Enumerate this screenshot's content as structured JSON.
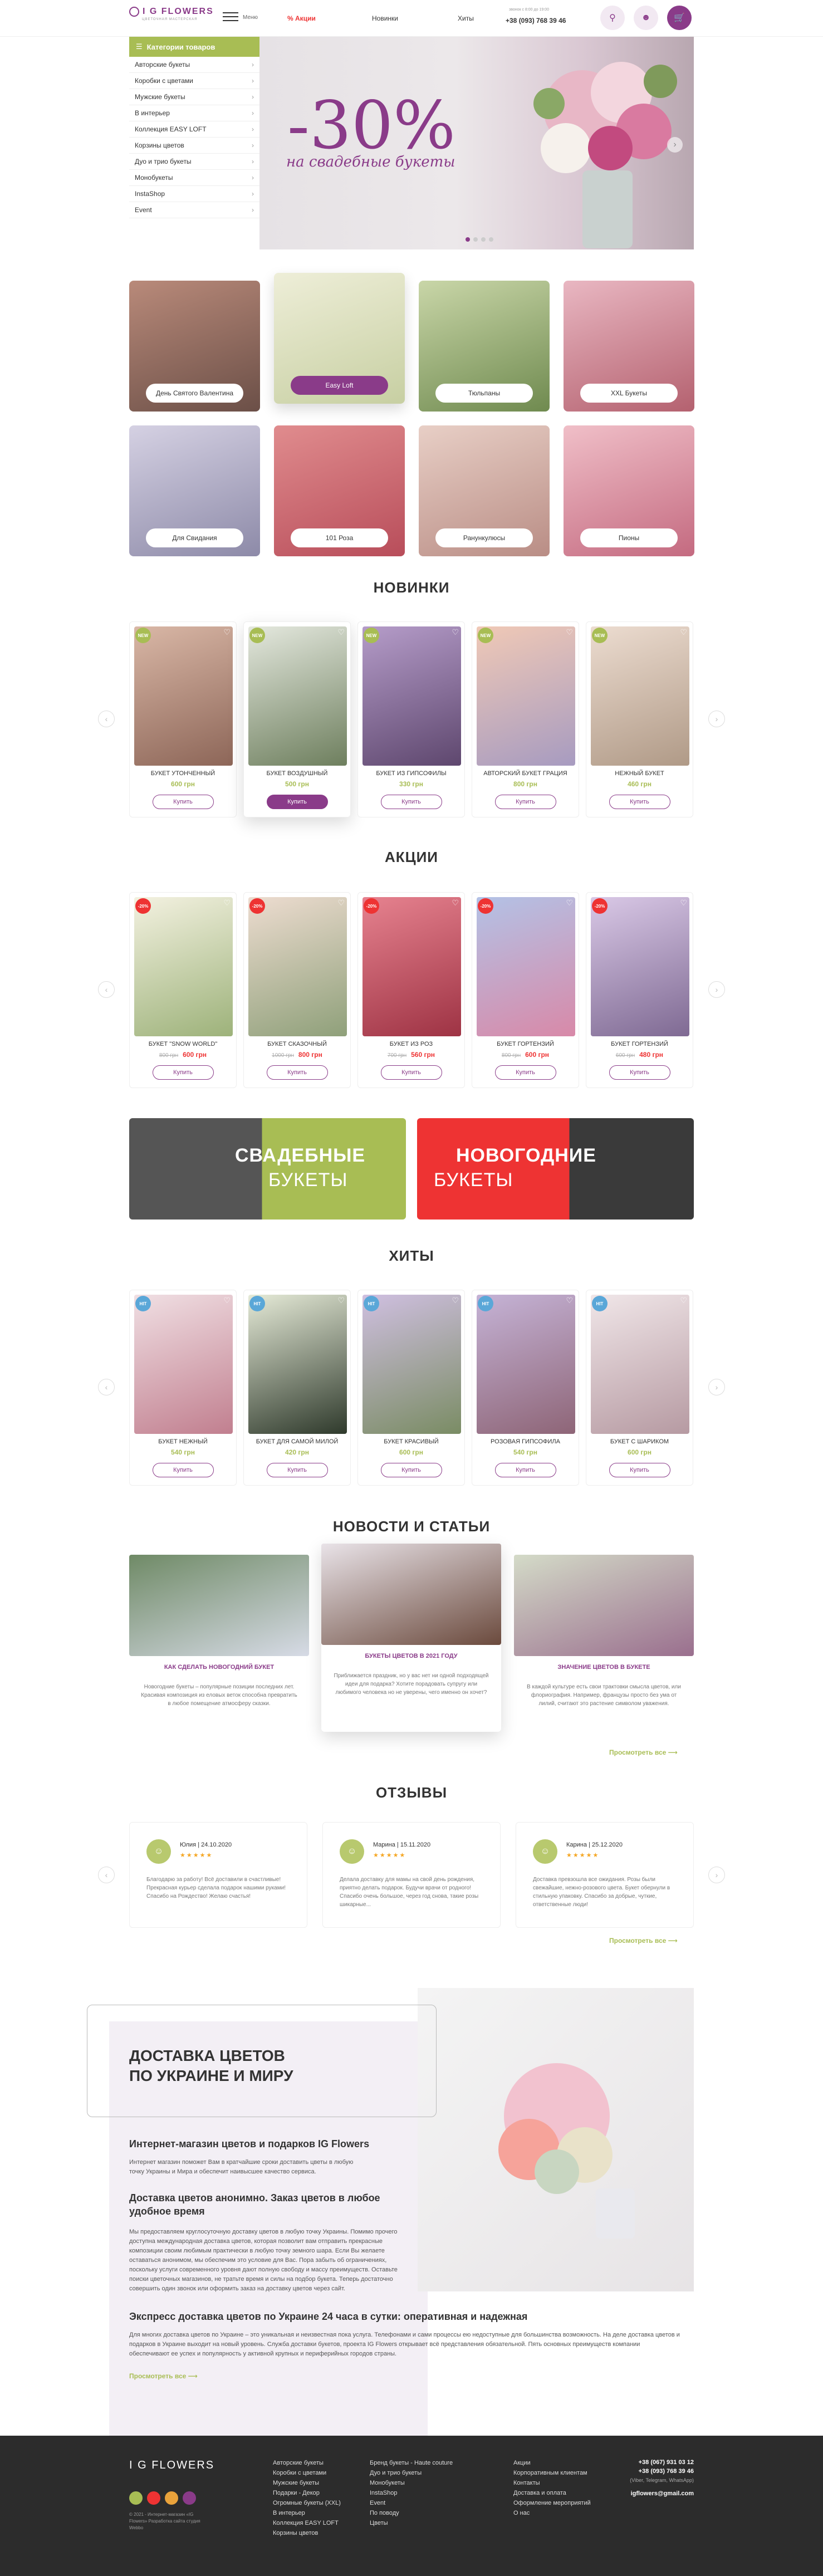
{
  "header": {
    "logo": "I G FLOWERS",
    "logo_sub": "ЦВЕТОЧНАЯ МАСТЕРСКАЯ",
    "menu_label": "Меню",
    "nav": [
      "Акции",
      "Новинки",
      "Хиты"
    ],
    "phone_note": "звонок с 8:00 до 19:00",
    "phone": "+38 (093) 768 39 46"
  },
  "sidebar": {
    "title": "Категории товаров",
    "items": [
      "Авторские букеты",
      "Коробки с цветами",
      "Мужские букеты",
      "В интерьер",
      "Коллекция EASY LOFT",
      "Корзины цветов",
      "Дуо и трио букеты",
      "Монобукеты",
      "InstaShop",
      "Event"
    ]
  },
  "hero": {
    "big": "-30%",
    "sub": "на свадебные букеты"
  },
  "tiles": [
    "День Святого Валентина",
    "Easy Loft",
    "Тюльпаны",
    "XXL Букеты",
    "Для Свидания",
    "101 Роза",
    "Ранункулюсы",
    "Пионы"
  ],
  "sections": {
    "new": "НОВИНКИ",
    "sale": "АКЦИИ",
    "hits": "ХИТЫ",
    "news": "НОВОСТИ И СТАТЬИ",
    "reviews": "ОТЗЫВЫ"
  },
  "buy_label": "Купить",
  "badges": {
    "new": "NEW",
    "sale": "-20%",
    "hit": "HIT"
  },
  "new_products": [
    {
      "name": "БУКЕТ УТОНЧЕННЫЙ",
      "price": "600 грн"
    },
    {
      "name": "БУКЕТ ВОЗДУШНЫЙ",
      "price": "500 грн"
    },
    {
      "name": "БУКЕТ ИЗ ГИПСОФИЛЫ",
      "price": "330 грн"
    },
    {
      "name": "АВТОРСКИЙ БУКЕТ ГРАЦИЯ",
      "price": "800 грн"
    },
    {
      "name": "НЕЖНЫЙ БУКЕТ",
      "price": "460 грн"
    }
  ],
  "sale_products": [
    {
      "name": "БУКЕТ \"SNOW WORLD\"",
      "old": "800 грн",
      "price": "600 грн"
    },
    {
      "name": "БУКЕТ СКАЗОЧНЫЙ",
      "old": "1000 грн",
      "price": "800 грн"
    },
    {
      "name": "БУКЕТ ИЗ РОЗ",
      "old": "700 грн",
      "price": "560 грн"
    },
    {
      "name": "БУКЕТ ГОРТЕНЗИЙ",
      "old": "800 грн",
      "price": "600 грн"
    },
    {
      "name": "БУКЕТ ГОРТЕНЗИЙ",
      "old": "600 грн",
      "price": "480 грн"
    }
  ],
  "hit_products": [
    {
      "name": "БУКЕТ НЕЖНЫЙ",
      "price": "540 грн"
    },
    {
      "name": "БУКЕТ ДЛЯ САМОЙ МИЛОЙ",
      "price": "420 грн"
    },
    {
      "name": "БУКЕТ КРАСИВЫЙ",
      "price": "600 грн"
    },
    {
      "name": "РОЗОВАЯ ГИПСОФИЛА",
      "price": "540 грн"
    },
    {
      "name": "БУКЕТ С ШАРИКОМ",
      "price": "600 грн"
    }
  ],
  "banners": {
    "wedding_t": "СВАДЕБНЫЕ",
    "wedding_s": "БУКЕТЫ",
    "newyear_t": "НОВОГОДНИЕ",
    "newyear_s": "БУКЕТЫ"
  },
  "news": [
    {
      "title": "КАК СДЕЛАТЬ НОВОГОДНИЙ БУКЕТ",
      "text": "Новогодние букеты – популярные позиции последних лет. Красивая композиция из еловых веток способна превратить в любое помещение атмосферу сказки."
    },
    {
      "title": "БУКЕТЫ ЦВЕТОВ В 2021 ГОДУ",
      "text": "Приближается праздник, но у вас нет ни одной подходящей идеи для подарка? Хотите порадовать супругу или любимого человека но не уверены, чего именно он хочет?"
    },
    {
      "title": "ЗНАЧЕНИЕ ЦВЕТОВ В БУКЕТЕ",
      "text": "В каждой культуре есть свои трактовки смысла цветов, или флориография. Например, французы просто без ума от лилий, считают это растение символом уважения."
    }
  ],
  "more_label": "Просмотреть все",
  "reviews": [
    {
      "name": "Юлия",
      "date": "24.10.2020",
      "text": "Благодарю за работу! Всё доставили в счастливые! Прекрасная курьер сделала подарок нашими руками! Спасибо на Рождество! Желаю счастья!"
    },
    {
      "name": "Марина",
      "date": "15.11.2020",
      "text": "Делала доставку для мамы на свой день рождения, приятно делать подарок. Будучи врачи от родного! Спасибо очень большое, через год снова, такие розы шикарные..."
    },
    {
      "name": "Карина",
      "date": "25.12.2020",
      "text": "Доставка превзошла все ожидания. Розы были свежайшие, нежно-розового цвета. Букет обернули в стильную упаковку. Спасибо за добрые, чуткие, ответственные люди!"
    }
  ],
  "about": {
    "title": "ДОСТАВКА ЦВЕТОВ ПО УКРАИНЕ И МИРУ",
    "h1": "Интернет-магазин цветов и подарков IG Flowers",
    "p1": "Интернет магазин поможет Вам в кратчайшие сроки доставить цветы в любую точку Украины и Мира и обеспечит наивысшее качество сервиса.",
    "h2": "Доставка цветов анонимно. Заказ цветов в любое удобное время",
    "p2": "Мы предоставляем круглосуточную доставку цветов в любую точку Украины. Помимо прочего доступна международная доставка цветов, которая позволит вам отправить прекрасные композиции своим любимым практически в любую точку земного шара. Если Вы желаете оставаться анонимом, мы обеспечим это условие для Вас. Пора забыть об ограничениях, поскольку услуги современного уровня дают полную свободу и массу преимуществ. Оставьте поиски цветочных магазинов, не тратьте время и силы на подбор букета. Теперь достаточно совершить один звонок или оформить заказ на доставку цветов через сайт.",
    "h3": "Экспресс доставка цветов по Украине 24 часа в сутки: оперативная и надежная",
    "p3": "Для многих доставка цветов по Украине – это уникальная и неизвестная пока услуга. Телефонами и сами процессы ею недоступные для большинства возможность. На деле доставка цветов и подарков в Украине выходит на новый уровень. Служба доставки букетов, проекта IG Flowers открывает всё представления обязательной. Пять основных преимуществ компании обеспечивают ее успех и популярность у активной крупных и периферийных городов страны.",
    "more": "Просмотреть все"
  },
  "footer": {
    "logo": "I G FLOWERS",
    "copy": "© 2021 - Интернет-магазин «IG Flowers» Разработка сайта студия Webbo",
    "col1": [
      "Авторские букеты",
      "Коробки с цветами",
      "Мужские букеты",
      "Подарки - Декор",
      "Огромные букеты (XXL)",
      "В интерьер",
      "Коллекция EASY LOFT",
      "Корзины цветов"
    ],
    "col2": [
      "Бренд букеты - Haute couture",
      "Дуо и трио букеты",
      "Монобукеты",
      "InstaShop",
      "Event",
      "По поводу",
      "Цветы"
    ],
    "col3": [
      "Акции",
      "Корпоративным клиентам",
      "Контакты",
      "Доставка и оплата",
      "Оформление мероприятий",
      "О нас"
    ],
    "phone1": "+38 (067) 931 03 12",
    "phone2": "+38 (093) 768 39 46",
    "phone_note": "(Viber, Telegram, WhatsApp)",
    "email": "igflowers@gmail.com"
  }
}
